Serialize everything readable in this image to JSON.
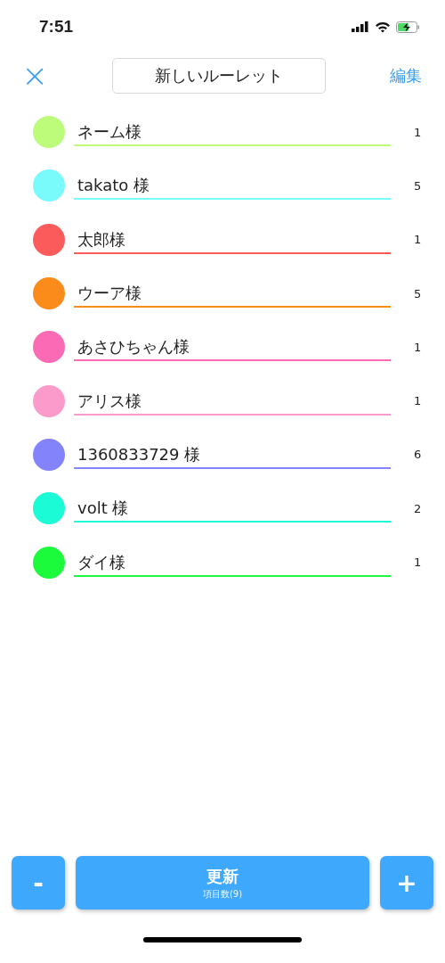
{
  "status_bar": {
    "time": "7:51"
  },
  "nav": {
    "close": "×",
    "title": "新しいルーレット",
    "edit": "編集"
  },
  "items": [
    {
      "name": "ネーム様",
      "count": "1",
      "color": "#bdfb7b"
    },
    {
      "name": "takato 様",
      "count": "5",
      "color": "#7afbfb"
    },
    {
      "name": "太郎様",
      "count": "1",
      "color": "#fb5b5b"
    },
    {
      "name": "ウーア様",
      "count": "5",
      "color": "#fb8b1b"
    },
    {
      "name": "あさひちゃん様",
      "count": "1",
      "color": "#fb6bb5"
    },
    {
      "name": "アリス様",
      "count": "1",
      "color": "#fb9bcb"
    },
    {
      "name": "1360833729 様",
      "count": "6",
      "color": "#8383fb"
    },
    {
      "name": "volt 様",
      "count": "2",
      "color": "#1bfbd5"
    },
    {
      "name": "ダイ様",
      "count": "1",
      "color": "#1bfb3b"
    }
  ],
  "toolbar": {
    "minus": "-",
    "update": "更新",
    "item_count": "項目数(9)",
    "plus": "+"
  }
}
